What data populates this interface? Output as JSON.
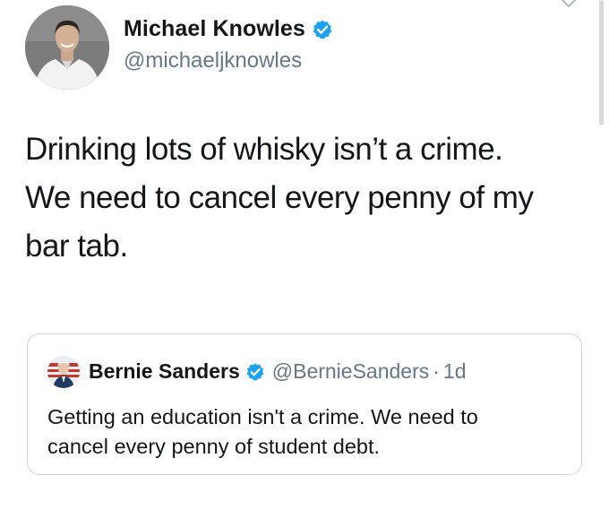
{
  "tweet": {
    "author_name": "Michael Knowles",
    "author_handle": "@michaeljknowles",
    "text_lines": [
      "Drinking lots of whisky isn’t a crime.",
      "We need to cancel every penny of my",
      "bar tab."
    ],
    "verified": true
  },
  "quoted_tweet": {
    "author_name": "Bernie Sanders",
    "author_handle": "@BernieSanders",
    "separator": "·",
    "time": "1d",
    "text_lines": [
      "Getting an education isn't a crime. We need to",
      "cancel every penny of student debt."
    ],
    "verified": true
  },
  "colors": {
    "verified_blue": "#1da1f2",
    "secondary_text": "#657786",
    "border": "#ccd6dd"
  },
  "icons": [
    "verified-badge-icon",
    "chevron-down-icon"
  ]
}
